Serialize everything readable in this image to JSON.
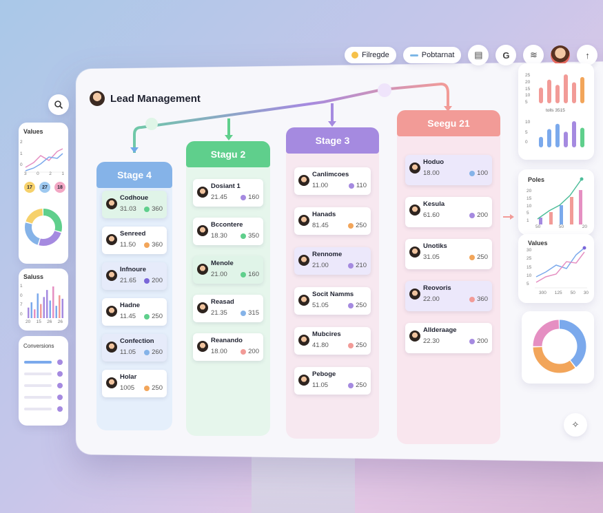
{
  "header": {
    "title": "Lead Management",
    "filter_label": "Filregde",
    "sort_label": "Pobtarnat"
  },
  "icons": [
    "search-icon",
    "filter-icon",
    "list-icon",
    "note-icon",
    "g-icon",
    "wifi-icon",
    "avatar",
    "arrow-up-icon",
    "more-icon",
    "pin-icon"
  ],
  "colors": {
    "stage4": "#85b3e8",
    "stage2": "#5fcf8c",
    "stage3": "#a58ae0",
    "stage21": "#f29b97",
    "accent": "#7a66d8"
  },
  "columns": [
    {
      "title": "Stage 4",
      "cards": [
        {
          "name": "Codhoue",
          "num": "31.03",
          "val": "360",
          "ic": "#5fcf8c"
        },
        {
          "name": "Senreed",
          "num": "11.50",
          "val": "360",
          "ic": "#f2a55a"
        },
        {
          "name": "Infnoure",
          "num": "21.65",
          "val": "200",
          "ic": "#7a66d8"
        },
        {
          "name": "Hadne",
          "num": "11.45",
          "val": "250",
          "ic": "#5fcf8c"
        },
        {
          "name": "Confection",
          "num": "11.05",
          "val": "260",
          "ic": "#85b3e8"
        },
        {
          "name": "Holar",
          "num": "1005",
          "val": "250",
          "ic": "#f2a55a"
        }
      ]
    },
    {
      "title": "Stagu 2",
      "cards": [
        {
          "name": "Dosiant 1",
          "num": "21.45",
          "val": "160",
          "ic": "#a58ae0"
        },
        {
          "name": "Bccontere",
          "num": "18.30",
          "val": "350",
          "ic": "#5fcf8c"
        },
        {
          "name": "Menole",
          "num": "21.00",
          "val": "160",
          "ic": "#5fcf8c"
        },
        {
          "name": "Reasad",
          "num": "21.35",
          "val": "315",
          "ic": "#85b3e8"
        },
        {
          "name": "Reanando",
          "num": "18.00",
          "val": "200",
          "ic": "#f29b97"
        }
      ]
    },
    {
      "title": "Stage 3",
      "cards": [
        {
          "name": "Canlimcoes",
          "num": "11.00",
          "val": "110",
          "ic": "#a58ae0"
        },
        {
          "name": "Hanads",
          "num": "81.45",
          "val": "250",
          "ic": "#f2a55a"
        },
        {
          "name": "Rennome",
          "num": "21.00",
          "val": "210",
          "ic": "#a58ae0"
        },
        {
          "name": "Socit Namms",
          "num": "51.05",
          "val": "250",
          "ic": "#a58ae0"
        },
        {
          "name": "Mubcires",
          "num": "41.80",
          "val": "250",
          "ic": "#f29b97"
        },
        {
          "name": "Peboge",
          "num": "11.05",
          "val": "250",
          "ic": "#a58ae0"
        }
      ]
    },
    {
      "title": "Seegu 21",
      "cards": [
        {
          "name": "Hoduo",
          "num": "18.00",
          "val": "100",
          "ic": "#85b3e8"
        },
        {
          "name": "Kesula",
          "num": "61.60",
          "val": "200",
          "ic": "#a58ae0"
        },
        {
          "name": "Unotiks",
          "num": "31.05",
          "val": "250",
          "ic": "#f2a55a"
        },
        {
          "name": "Reovoris",
          "num": "22.00",
          "val": "360",
          "ic": "#f29b97"
        },
        {
          "name": "Allderaage",
          "num": "22.30",
          "val": "200",
          "ic": "#a58ae0"
        }
      ]
    }
  ],
  "left_panels": {
    "values_label": "Values",
    "values_ticks": [
      "3",
      "0",
      "2",
      "1"
    ],
    "values_y": [
      "2",
      "1",
      "0"
    ],
    "badges": [
      {
        "text": "17",
        "color": "#f6d16b"
      },
      {
        "text": "27",
        "color": "#9ec9f0"
      },
      {
        "text": "18",
        "color": "#f2a7c4"
      }
    ],
    "donut": [
      {
        "value": 30,
        "color": "#5fcf8c"
      },
      {
        "value": 25,
        "color": "#a58ae0"
      },
      {
        "value": 25,
        "color": "#85b3e8"
      },
      {
        "value": 20,
        "color": "#f6d16b"
      }
    ],
    "sales_label": "Saluss",
    "sales_bars": [
      6,
      9,
      5,
      14,
      8,
      12,
      16,
      10,
      18,
      7,
      13,
      11
    ],
    "sales_ticks": [
      "20",
      "15",
      "26",
      "26"
    ],
    "sales_y": [
      "1",
      "0",
      "7",
      "0"
    ],
    "conversions_label": "Conversions"
  },
  "right_panels": {
    "top_label": "tolls 3515",
    "top_bars": [
      {
        "value": 12,
        "color": "#f29b97"
      },
      {
        "value": 18,
        "color": "#f29b97"
      },
      {
        "value": 14,
        "color": "#f29b97"
      },
      {
        "value": 22,
        "color": "#f29b97"
      },
      {
        "value": 16,
        "color": "#f29b97"
      },
      {
        "value": 20,
        "color": "#f2a55a"
      }
    ],
    "top_bars2": [
      {
        "value": 8,
        "color": "#7ba9ec"
      },
      {
        "value": 14,
        "color": "#7ba9ec"
      },
      {
        "value": 18,
        "color": "#7ba9ec"
      },
      {
        "value": 12,
        "color": "#a58ae0"
      },
      {
        "value": 20,
        "color": "#a58ae0"
      },
      {
        "value": 15,
        "color": "#5fcf8c"
      }
    ],
    "top_y": [
      "25",
      "20",
      "15",
      "10",
      "5"
    ],
    "top_y2": [
      "10",
      "5",
      "0"
    ],
    "poles_label": "Poles",
    "poles_ticks": [
      "50",
      "50",
      "20"
    ],
    "poles_y": [
      "20",
      "15",
      "10",
      "5",
      "1"
    ],
    "values_label": "Values",
    "values_ticks": [
      "300",
      "125",
      "50",
      "30"
    ],
    "values_y": [
      "30",
      "25",
      "15",
      "10",
      "5"
    ],
    "donut": [
      {
        "value": 40,
        "color": "#7ba9ec"
      },
      {
        "value": 35,
        "color": "#f2a55a"
      },
      {
        "value": 25,
        "color": "#e58fc2"
      }
    ]
  }
}
